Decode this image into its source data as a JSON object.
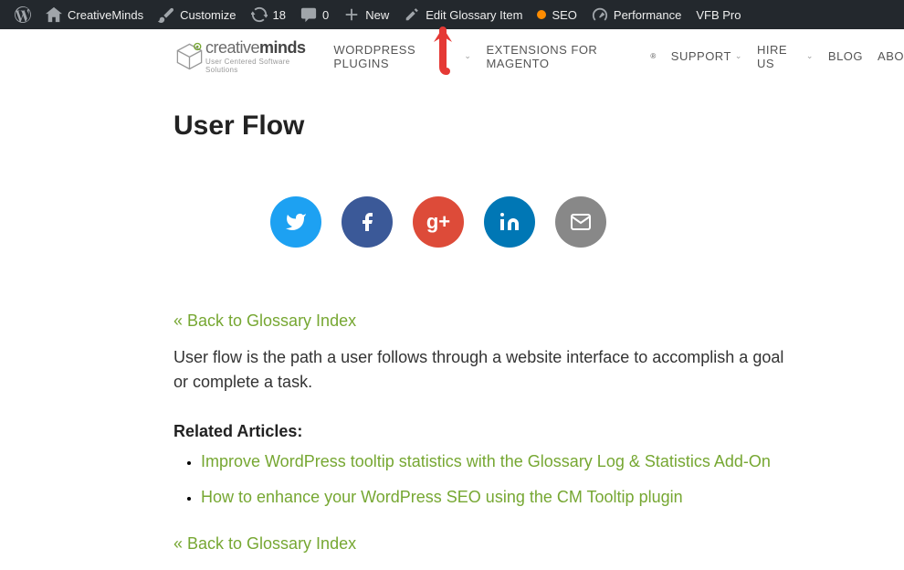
{
  "adminBar": {
    "siteName": "CreativeMinds",
    "customize": "Customize",
    "updates": "18",
    "comments": "0",
    "new": "New",
    "editGlossary": "Edit Glossary Item",
    "seo": "SEO",
    "performance": "Performance",
    "vfb": "VFB Pro"
  },
  "header": {
    "logoMain": "creative",
    "logoBold": "minds",
    "logoSub": "User Centered Software Solutions",
    "nav": {
      "plugins": "WORDPRESS PLUGINS",
      "magento": "EXTENSIONS FOR MAGENTO",
      "support": "SUPPORT",
      "hire": "HIRE US",
      "blog": "BLOG",
      "about": "ABO"
    }
  },
  "content": {
    "title": "User Flow",
    "backTop": "« Back to Glossary Index",
    "description": "User flow is the path a user follows through a website interface to accomplish a goal or complete a task.",
    "relatedHeading": "Related Articles:",
    "related": [
      "Improve WordPress tooltip statistics with the Glossary Log & Statistics Add-On",
      "How to enhance your WordPress SEO using the CM Tooltip plugin"
    ],
    "backBottom": "« Back to Glossary Index"
  }
}
